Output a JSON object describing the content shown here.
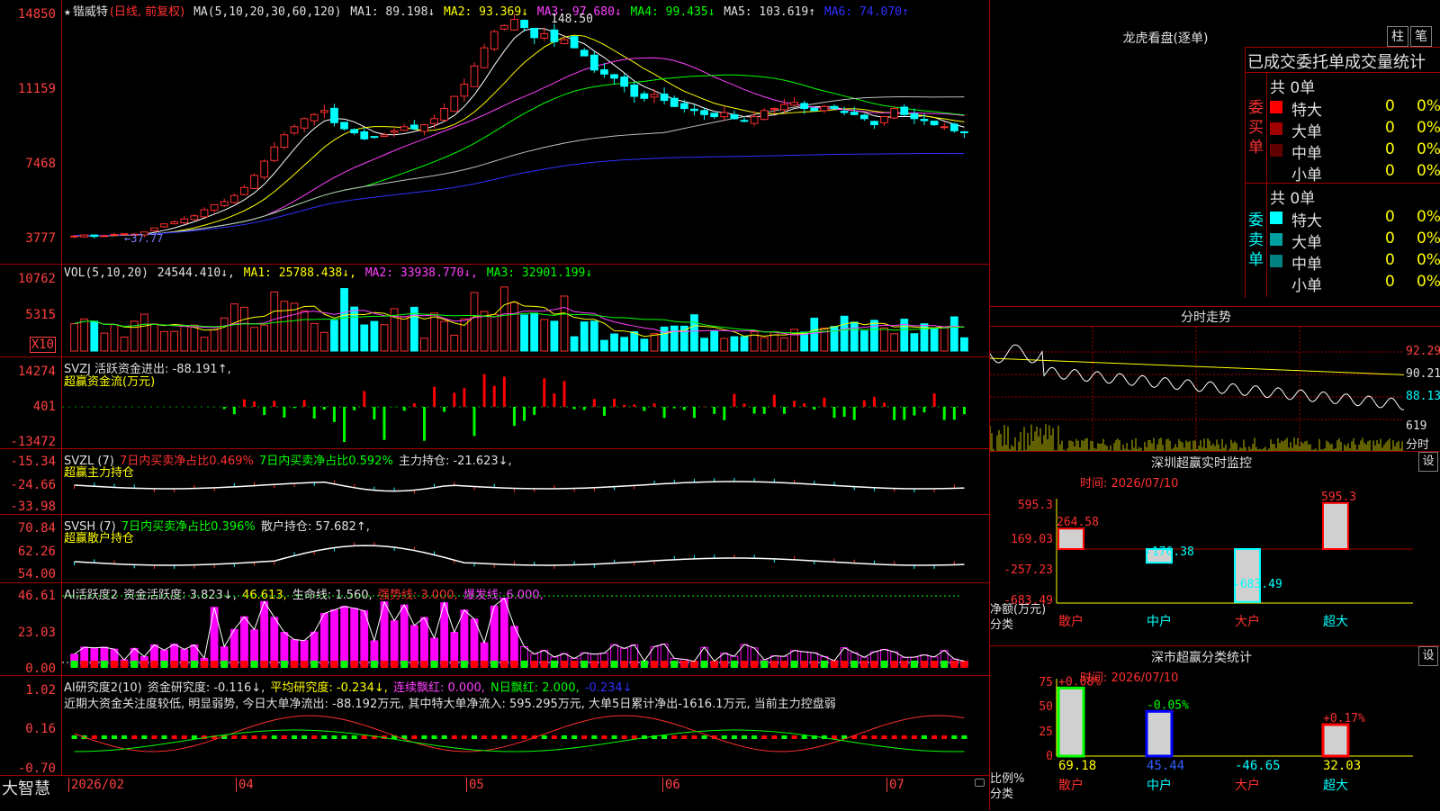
{
  "stock": {
    "name_star": "★",
    "name": "锴威特",
    "mode": "(日线, 前复权)",
    "ma_label": "MA(5,10,20,30,60,120)",
    "ma1": "MA1: 89.198↓",
    "ma2": "MA2: 93.369↓",
    "ma3": "MA3: 97.680↓",
    "ma4": "MA4: 99.435↓",
    "ma5": "MA5: 103.619↑",
    "ma6": "MA6: 74.070↑",
    "high_label": "148.50",
    "low_label": "37.77",
    "y_ticks": [
      "14850",
      "11159",
      "7468",
      "3777"
    ]
  },
  "vol": {
    "header": "VOL(5,10,20)",
    "value": "24544.410↓,",
    "ma1": "MA1: 25788.438↓,",
    "ma2": "MA2: 33938.770↓,",
    "ma3": "MA3: 32901.199↓",
    "y_ticks": [
      "10762",
      "5315"
    ],
    "unit": "X10"
  },
  "svzj": {
    "header": "SVZJ  活跃资金进出: -88.191↑,",
    "sub": "超赢资金流(万元)",
    "y_ticks": [
      "14274",
      "401",
      "-13472"
    ]
  },
  "svzl": {
    "header_a": "SVZL (7)",
    "header_b": "7日内买卖净占比0.469%",
    "header_c": "7日内买卖净占比0.592%",
    "header_d": "主力持仓: -21.623↓,",
    "sub": "超赢主力持仓",
    "y_ticks": [
      "-15.34",
      "-24.66",
      "-33.98"
    ]
  },
  "svsh": {
    "header_a": "SVSH (7)",
    "header_b": "7日内买卖净占比0.396%",
    "header_c": "散户持仓: 57.682↑,",
    "sub": "超赢散户持仓",
    "y_ticks": [
      "70.84",
      "62.26",
      "54.00"
    ]
  },
  "ai1": {
    "header_a": "AI活跃度2",
    "header_b": "资金活跃度: 3.823↓,",
    "header_c": "46.613,",
    "header_d": "生命线: 1.560,",
    "header_e": "强势线: 3.000,",
    "header_f": "爆发线: 6.000,",
    "y_ticks": [
      "46.61",
      "23.03",
      "0.00"
    ]
  },
  "ai2": {
    "header_a": "AI研究度2(10)",
    "header_b": "资金研究度: -0.116↓,",
    "header_c": "平均研究度: -0.234↓,",
    "header_d": "连续飘红: 0.000,",
    "header_e": "N日飘红: 2.000,",
    "header_f": "-0.234↓",
    "note": "近期大资金关注度较低, 明显弱势, 今日大单净流出: -88.192万元, 其中特大单净流入: 595.295万元, 大单5日累计净出-1616.1万元, 当前主力控盘弱",
    "y_ticks": [
      "1.02",
      "0.16",
      "-0.70"
    ]
  },
  "xaxis": {
    "brand": "大智慧",
    "labels": [
      "2026/02",
      "04",
      "05",
      "06",
      "07"
    ]
  },
  "dragon": {
    "title": "龙虎看盘(逐单)",
    "tab_zhu": "柱",
    "tab_bi": "笔",
    "subtitle": "已成交委托单成交量统计",
    "buy_label": "委买单",
    "sell_label": "委卖单",
    "buy_total": "共 0单",
    "sell_total": "共 0单",
    "buy_rows": [
      {
        "name": "特大",
        "count": "0",
        "pct": "0%",
        "color": "#ff0000"
      },
      {
        "name": "大单",
        "count": "0",
        "pct": "0%",
        "color": "#a00000"
      },
      {
        "name": "中单",
        "count": "0",
        "pct": "0%",
        "color": "#600000"
      },
      {
        "name": "小单",
        "count": "0",
        "pct": "0%",
        "color": ""
      }
    ],
    "sell_rows": [
      {
        "name": "特大",
        "count": "0",
        "pct": "0%",
        "color": "#00ffff"
      },
      {
        "name": "大单",
        "count": "0",
        "pct": "0%",
        "color": "#00a0a0"
      },
      {
        "name": "中单",
        "count": "0",
        "pct": "0%",
        "color": "#008080"
      },
      {
        "name": "小单",
        "count": "0",
        "pct": "0%",
        "color": ""
      }
    ]
  },
  "intraday": {
    "title": "分时走势",
    "y_ticks": [
      "92.29",
      "90.21",
      "88.13"
    ],
    "vol_tick": "619",
    "footer": "分时"
  },
  "monitor": {
    "title": "深圳超赢实时监控",
    "set": "设",
    "time": "时间: 2026/07/10",
    "y_ticks": [
      "595.3",
      "169.03",
      "-257.23",
      "-683.49"
    ],
    "ylabel": "净额(万元)",
    "xlabel": "分类",
    "bars": [
      {
        "cat": "散户",
        "value": 264.58,
        "label": "264.58",
        "color": "#ff0000"
      },
      {
        "cat": "中户",
        "value": -176.38,
        "label": "-176.38",
        "color": "#00ffff"
      },
      {
        "cat": "大户",
        "value": -683.49,
        "label": "-683.49",
        "color": "#00ffff"
      },
      {
        "cat": "超大",
        "value": 595.3,
        "label": "595.3",
        "color": "#ff0000"
      }
    ]
  },
  "classify": {
    "title": "深市超赢分类统计",
    "set": "设",
    "time": "时间: 2026/07/10",
    "y_ticks": [
      "75",
      "50",
      "25",
      "0"
    ],
    "ylabel": "比例%",
    "xlabel": "分类",
    "bars": [
      {
        "cat": "散户",
        "value": 69.18,
        "pct": "+0.08%",
        "label": "69.18",
        "color": "#00ff00"
      },
      {
        "cat": "中户",
        "value": 45.44,
        "pct": "-0.05%",
        "label": "45.44",
        "color": "#0000ff"
      },
      {
        "cat": "大户",
        "value": -46.65,
        "pct": "",
        "label": "-46.65",
        "color": "#00ffff"
      },
      {
        "cat": "超大",
        "value": 32.03,
        "pct": "+0.17%",
        "label": "32.03",
        "color": "#ff0000"
      }
    ]
  },
  "chart_data": {
    "type": "candlestick",
    "title": "锴威特 (日线, 前复权)",
    "ylim": [
      3777,
      14850
    ],
    "close_path": [
      3900,
      3950,
      3880,
      3920,
      3980,
      4010,
      3990,
      4100,
      4300,
      4500,
      4600,
      4750,
      4900,
      5200,
      5450,
      5600,
      5900,
      6300,
      6900,
      7600,
      8300,
      8900,
      9300,
      9700,
      9900,
      10100,
      9500,
      9200,
      9000,
      8700,
      8800,
      8900,
      9100,
      9300,
      9200,
      9400,
      9700,
      10200,
      10800,
      11400,
      12300,
      13200,
      14000,
      14300,
      14600,
      14200,
      13700,
      13900,
      13500,
      13600,
      13200,
      12800,
      12100,
      11900,
      11700,
      11300,
      10800,
      10700,
      10900,
      10600,
      10300,
      10200,
      10100,
      9900,
      9800,
      10000,
      9700,
      9600,
      9800,
      10100,
      10200,
      10400,
      10500,
      10200,
      10100,
      10300,
      10200,
      10000,
      9900,
      9700,
      9400,
      9800,
      10200,
      9900,
      9700,
      9600,
      9400,
      9300,
      9100,
      9000
    ]
  }
}
